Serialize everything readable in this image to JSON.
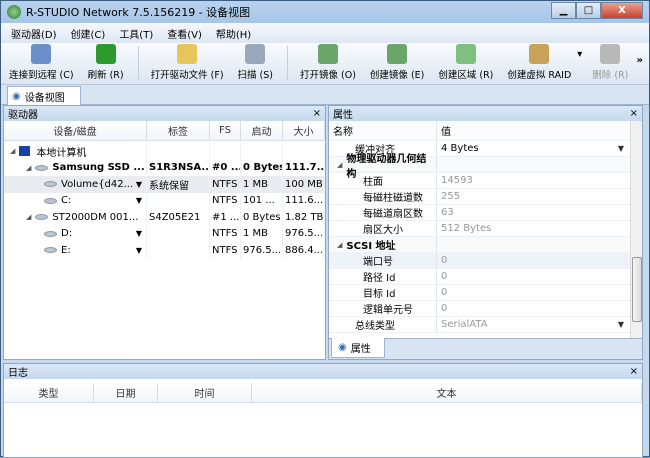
{
  "window": {
    "title": "R-STUDIO Network 7.5.156219 - 设备视图",
    "minimize": "▁",
    "maximize": "□",
    "close": "X"
  },
  "menu": [
    "驱动器(D)",
    "创建(C)",
    "工具(T)",
    "查看(V)",
    "帮助(H)"
  ],
  "toolbar": [
    {
      "label": "连接到远程 (C)",
      "icon": "network-computers-icon",
      "color": "#6b8fc9"
    },
    {
      "label": "刷新 (R)",
      "icon": "refresh-icon",
      "color": "#2e9a2e"
    },
    {
      "label": "打开驱动文件 (F)",
      "icon": "open-folder-icon",
      "color": "#e8c55a"
    },
    {
      "label": "扫描 (S)",
      "icon": "scan-icon",
      "color": "#9aa8bb"
    },
    {
      "label": "打开镜像 (O)",
      "icon": "open-image-icon",
      "color": "#6aa56a"
    },
    {
      "label": "创建镜像 (E)",
      "icon": "create-image-icon",
      "color": "#6aa56a"
    },
    {
      "label": "创建区域 (R)",
      "icon": "create-region-icon",
      "color": "#7ec07e"
    },
    {
      "label": "创建虚拟 RAID",
      "icon": "raid-icon",
      "color": "#c9a25a"
    },
    {
      "label": "删除 (R)",
      "icon": "delete-icon",
      "color": "#b8b8b8"
    }
  ],
  "toolbar_more": "»",
  "tabs": {
    "device_view": "设备视图",
    "properties": "属性"
  },
  "drives": {
    "title": "驱动器",
    "columns": [
      "设备/磁盘",
      "标签",
      "FS",
      "启动",
      "大小"
    ],
    "rows": [
      {
        "name": "本地计算机",
        "label": "",
        "fs": "",
        "start": "",
        "size": "",
        "level": 0,
        "bold": false
      },
      {
        "name": "Samsung SSD ...",
        "label": "S1R3NSA...",
        "fs": "#0 ...",
        "start": "0 Bytes",
        "size": "111.7...",
        "level": 1,
        "bold": true
      },
      {
        "name": "Volume{d42...",
        "label": "系统保留",
        "fs": "NTFS",
        "start": "1 MB",
        "size": "100 MB",
        "level": 2,
        "bold": false
      },
      {
        "name": "C:",
        "label": "",
        "fs": "NTFS",
        "start": "101 ...",
        "size": "111.6...",
        "level": 2,
        "bold": false
      },
      {
        "name": "ST2000DM 001...",
        "label": "S4Z05E21",
        "fs": "#1 ...",
        "start": "0 Bytes",
        "size": "1.82 TB",
        "level": 1,
        "bold": false
      },
      {
        "name": "D:",
        "label": "",
        "fs": "NTFS",
        "start": "1 MB",
        "size": "976.5...",
        "level": 2,
        "bold": false
      },
      {
        "name": "E:",
        "label": "",
        "fs": "NTFS",
        "start": "976.5...",
        "size": "886.4...",
        "level": 2,
        "bold": false
      }
    ]
  },
  "properties": {
    "title": "属性",
    "columns": [
      "名称",
      "值"
    ],
    "rows": [
      {
        "name": "缓冲对齐",
        "value": "4 Bytes",
        "dropdown": true
      },
      {
        "name": "物理驱动器几何结构",
        "value": "",
        "group": true
      },
      {
        "name": "柱面",
        "value": "14593",
        "gray": true
      },
      {
        "name": "每磁柱磁道数",
        "value": "255",
        "gray": true
      },
      {
        "name": "每磁道扇区数",
        "value": "63",
        "gray": true
      },
      {
        "name": "扇区大小",
        "value": "512 Bytes",
        "gray": true
      },
      {
        "name": "SCSI 地址",
        "value": "",
        "group": true
      },
      {
        "name": "端口号",
        "value": "0",
        "gray": true
      },
      {
        "name": "路径 Id",
        "value": "0",
        "gray": true
      },
      {
        "name": "目标 Id",
        "value": "0",
        "gray": true
      },
      {
        "name": "逻辑单元号",
        "value": "0",
        "gray": true
      },
      {
        "name": "总线类型",
        "value": "SerialATA",
        "gray": true,
        "dropdown": true
      }
    ]
  },
  "log": {
    "title": "日志",
    "columns": [
      "类型",
      "日期",
      "时间",
      "文本"
    ]
  }
}
